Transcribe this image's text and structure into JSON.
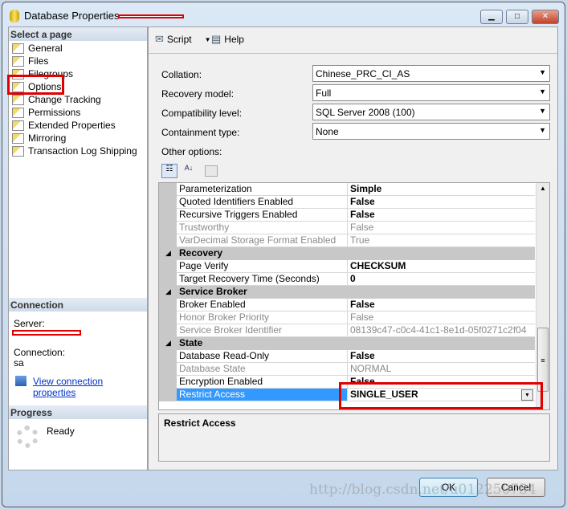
{
  "window": {
    "title": "Database Properties - ",
    "minimize": "▁",
    "maximize": "□",
    "close": "✕"
  },
  "sidebar": {
    "select_header": "Select a page",
    "items": [
      {
        "label": "General"
      },
      {
        "label": "Files"
      },
      {
        "label": "Filegroups"
      },
      {
        "label": "Options"
      },
      {
        "label": "Change Tracking"
      },
      {
        "label": "Permissions"
      },
      {
        "label": "Extended Properties"
      },
      {
        "label": "Mirroring"
      },
      {
        "label": "Transaction Log Shipping"
      }
    ],
    "connection_header": "Connection",
    "server_label": "Server:",
    "connection_label": "Connection:",
    "connection_value": "sa",
    "view_link": "View connection properties",
    "progress_header": "Progress",
    "progress_status": "Ready"
  },
  "toolbar": {
    "script": "Script",
    "help": "Help"
  },
  "form": {
    "collation_label": "Collation:",
    "collation": "Chinese_PRC_CI_AS",
    "recovery_label": "Recovery model:",
    "recovery": "Full",
    "compat_label": "Compatibility level:",
    "compat": "SQL Server 2008 (100)",
    "containment_label": "Containment type:",
    "containment": "None",
    "other_label": "Other options:"
  },
  "grid": {
    "rows": [
      {
        "name": "Parameterization",
        "value": "Simple"
      },
      {
        "name": "Quoted Identifiers Enabled",
        "value": "False"
      },
      {
        "name": "Recursive Triggers Enabled",
        "value": "False"
      },
      {
        "name": "Trustworthy",
        "value": "False",
        "readonly": true
      },
      {
        "name": "VarDecimal Storage Format Enabled",
        "value": "True",
        "readonly": true
      },
      {
        "name": "Recovery",
        "category": true
      },
      {
        "name": "Page Verify",
        "value": "CHECKSUM"
      },
      {
        "name": "Target Recovery Time (Seconds)",
        "value": "0"
      },
      {
        "name": "Service Broker",
        "category": true
      },
      {
        "name": "Broker Enabled",
        "value": "False"
      },
      {
        "name": "Honor Broker Priority",
        "value": "False",
        "readonly": true
      },
      {
        "name": "Service Broker Identifier",
        "value": "08139c47-c0c4-41c1-8e1d-05f0271c2f04",
        "readonly": true
      },
      {
        "name": "State",
        "category": true
      },
      {
        "name": "Database Read-Only",
        "value": "False"
      },
      {
        "name": "Database State",
        "value": "NORMAL",
        "readonly": true
      },
      {
        "name": "Encryption Enabled",
        "value": "False"
      },
      {
        "name": "Restrict Access",
        "value": "SINGLE_USER",
        "selected": true
      }
    ]
  },
  "description": {
    "title": "Restrict Access"
  },
  "buttons": {
    "ok": "OK",
    "cancel": "Cancel"
  },
  "watermark": "http://blog.csdn.net/u012250754",
  "colors": {
    "highlight": "#e00000",
    "selection": "#3399ff"
  }
}
